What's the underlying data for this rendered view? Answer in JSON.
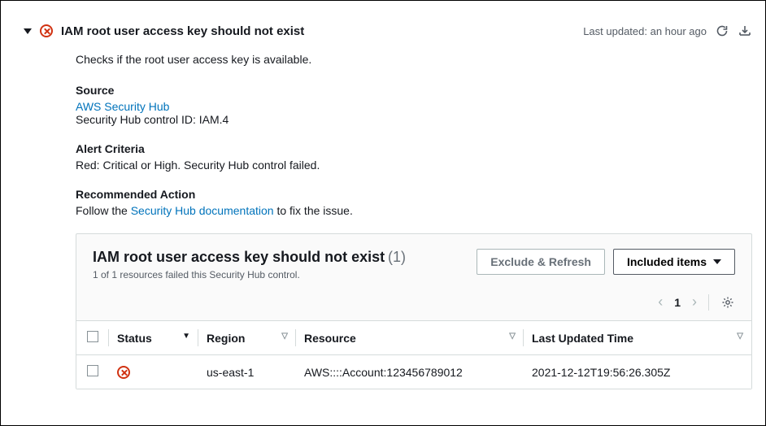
{
  "header": {
    "title": "IAM root user access key should not exist",
    "last_updated_label": "Last updated: an hour ago"
  },
  "details": {
    "description": "Checks if the root user access key is available.",
    "source_label": "Source",
    "source_link": "AWS Security Hub",
    "source_id_line": "Security Hub control ID: IAM.4",
    "criteria_label": "Alert Criteria",
    "criteria_text": "Red: Critical or High. Security Hub control failed.",
    "action_label": "Recommended Action",
    "action_prefix": "Follow the ",
    "action_link": "Security Hub documentation",
    "action_suffix": " to fix the issue."
  },
  "panel": {
    "title": "IAM root user access key should not exist",
    "count": "(1)",
    "subtitle": "1 of 1 resources failed this Security Hub control.",
    "exclude_btn": "Exclude & Refresh",
    "included_btn": "Included items",
    "page": "1",
    "columns": {
      "status": "Status",
      "region": "Region",
      "resource": "Resource",
      "last_updated": "Last Updated Time"
    },
    "rows": [
      {
        "region": "us-east-1",
        "resource": "AWS::::Account:123456789012",
        "last_updated": "2021-12-12T19:56:26.305Z"
      }
    ]
  }
}
